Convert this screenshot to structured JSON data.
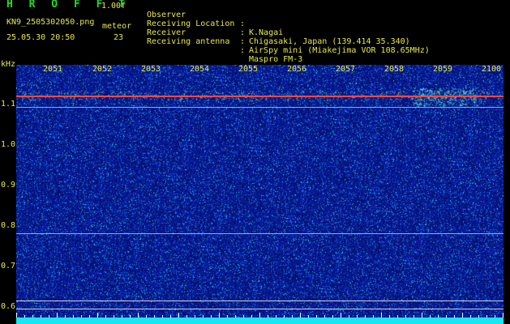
{
  "header": {
    "app_title": "H R O F F T",
    "version": "1.00f",
    "filename": "KN9_2505302050.png",
    "datetime": "25.05.30 20:50",
    "meteor_label": "meteor",
    "meteor_count": "23"
  },
  "info": [
    {
      "key": "Observer",
      "value": "K.Nagai"
    },
    {
      "key": "Receiving Location",
      "value": "Chigasaki, Japan (139.414 35.340)"
    },
    {
      "key": "Receiver",
      "value": "AirSpy mini (Miakejima VOR 108.65MHz)"
    },
    {
      "key": "Receiving antenna",
      "value": "Maspro FM-3"
    }
  ],
  "separator": ":",
  "axes": {
    "y_unit": "kHz",
    "y_labels": [
      "1.1",
      "1.0",
      "0.9",
      "0.8",
      "0.7",
      "0.6"
    ],
    "x_labels": [
      "2051",
      "2052",
      "2053",
      "2054",
      "2055",
      "2056",
      "2057",
      "2058",
      "2059",
      "2100"
    ]
  },
  "colors": {
    "background": "#000000",
    "text": "#e8e84a",
    "title": "#2bd92b",
    "noise_floor": "#0a1e9c",
    "baseline": "#18e6f0",
    "signal": "#ff4a4a"
  }
}
